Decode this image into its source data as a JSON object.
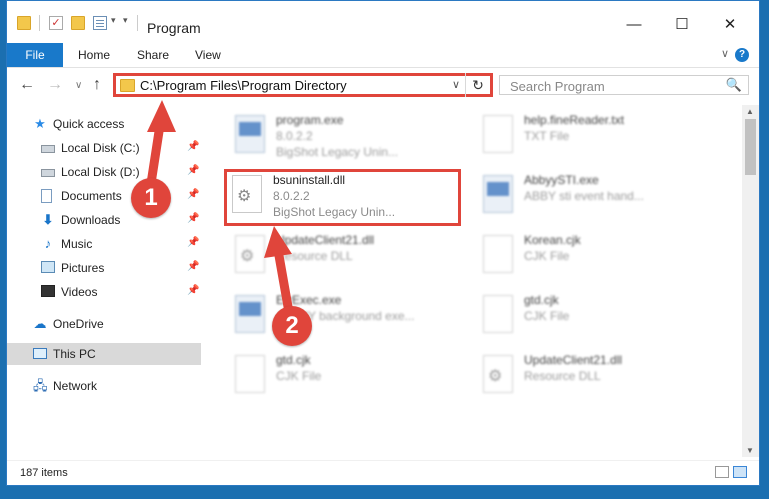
{
  "window": {
    "title": "Program",
    "min_label": "—",
    "max_label": "☐",
    "close_label": "✕"
  },
  "ribbon": {
    "file_tab": "File",
    "tabs": [
      "Home",
      "Share",
      "View"
    ],
    "help": "?",
    "collapse_chevron": "∨"
  },
  "navbar": {
    "back": "←",
    "forward": "→",
    "recent": "∨",
    "up": "↑",
    "address_path": "C:\\Program Files\\Program Directory",
    "address_chevron": "∨",
    "refresh": "↻",
    "search_placeholder": "Search Program",
    "search_icon": "🔍"
  },
  "sidebar": {
    "items": [
      {
        "label": "Quick access",
        "icon": "star-icon",
        "glyph": "★",
        "pinned": false
      },
      {
        "label": "Local Disk (C:)",
        "icon": "drive-icon",
        "glyph": "",
        "pinned": true
      },
      {
        "label": "Local Disk (D:)",
        "icon": "drive-icon",
        "glyph": "",
        "pinned": true
      },
      {
        "label": "Documents",
        "icon": "document-icon",
        "glyph": "",
        "pinned": true
      },
      {
        "label": "Downloads",
        "icon": "download-icon",
        "glyph": "⬇",
        "pinned": true
      },
      {
        "label": "Music",
        "icon": "music-icon",
        "glyph": "♪",
        "pinned": true
      },
      {
        "label": "Pictures",
        "icon": "pictures-icon",
        "glyph": "",
        "pinned": true
      },
      {
        "label": "Videos",
        "icon": "video-icon",
        "glyph": "",
        "pinned": true
      },
      {
        "label": "OneDrive",
        "icon": "cloud-icon",
        "glyph": "☁",
        "pinned": false
      },
      {
        "label": "This PC",
        "icon": "computer-icon",
        "glyph": "",
        "pinned": false
      },
      {
        "label": "Network",
        "icon": "network-icon",
        "glyph": "🖧",
        "pinned": false
      }
    ],
    "pin_glyph": "📌"
  },
  "files": {
    "left": [
      {
        "name": "program.exe",
        "line1": "8.0.2.2",
        "line2": "BigShot Legacy Unin...",
        "type": "exe"
      },
      {
        "name": "bsuninstall.dll",
        "line1": "8.0.2.2",
        "line2": "BigShot Legacy Unin...",
        "type": "dll"
      },
      {
        "name": "UpdateClient21.dll",
        "line1": "Resource DLL",
        "line2": "",
        "type": "dll"
      },
      {
        "name": "ErrExec.exe",
        "line1": "ABBYY background exe...",
        "line2": "",
        "type": "exe"
      },
      {
        "name": "gtd.cjk",
        "line1": "CJK File",
        "line2": "",
        "type": "doc"
      }
    ],
    "right": [
      {
        "name": "help.fineReader.txt",
        "line1": "TXT File",
        "line2": "",
        "type": "doc"
      },
      {
        "name": "AbbyySTI.exe",
        "line1": "ABBY sti event hand...",
        "line2": "",
        "type": "exe"
      },
      {
        "name": "Korean.cjk",
        "line1": "CJK File",
        "line2": "",
        "type": "doc"
      },
      {
        "name": "gtd.cjk",
        "line1": "CJK File",
        "line2": "",
        "type": "doc"
      },
      {
        "name": "UpdateClient21.dll",
        "line1": "Resource DLL",
        "line2": "",
        "type": "dll"
      }
    ]
  },
  "status": {
    "item_count": "187 items"
  },
  "callouts": [
    "1",
    "2"
  ],
  "colors": {
    "accent": "#1979ca",
    "highlight": "#e0453b",
    "desktop": "#1b6fb0"
  }
}
